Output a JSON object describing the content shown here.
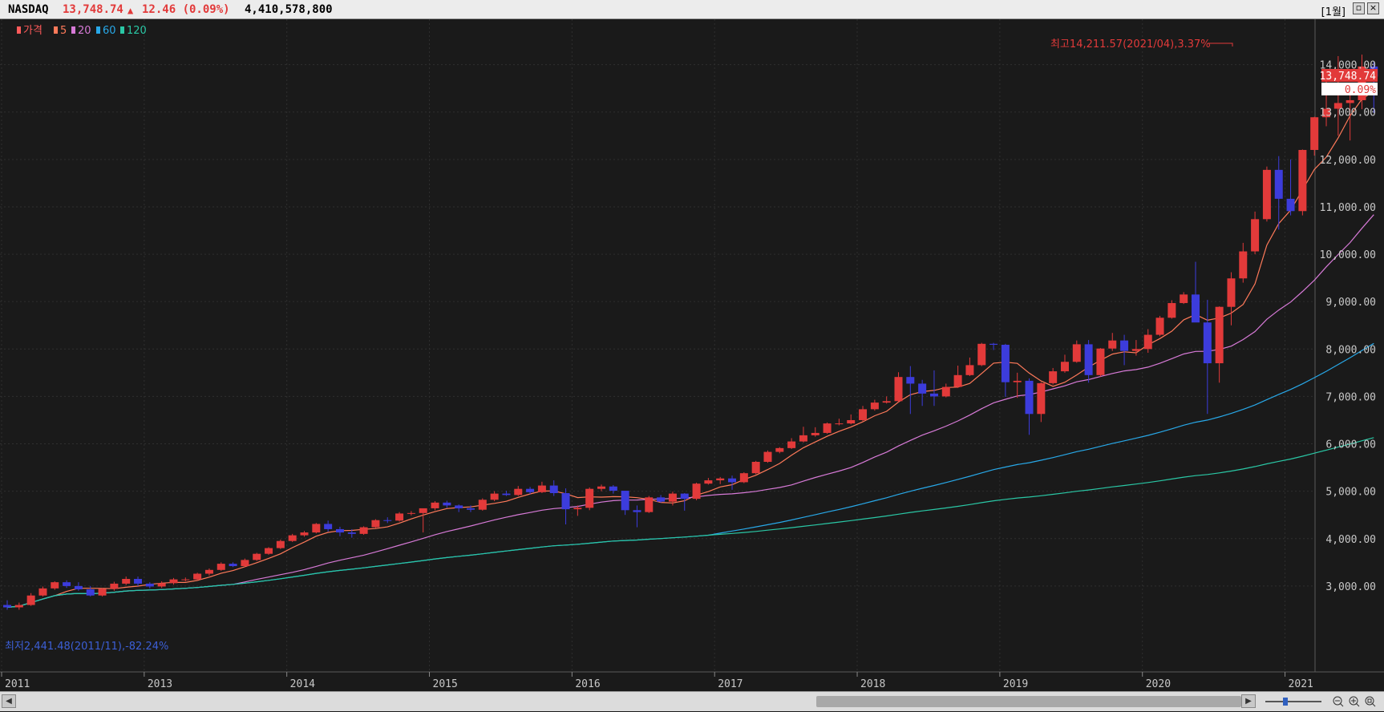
{
  "header": {
    "symbol": "NASDAQ",
    "price": "13,748.74",
    "change_arrow": "▲",
    "change": "12.46 (0.09%)",
    "volume": "4,410,578,800",
    "period": "[1월]",
    "up_color": "#ff4b4b"
  },
  "legend": [
    {
      "label": "가격",
      "color": "#ff5a5a"
    },
    {
      "label": "5",
      "color": "#ff7a5a"
    },
    {
      "label": "20",
      "color": "#d77ad7"
    },
    {
      "label": "60",
      "color": "#28a8e8"
    },
    {
      "label": "120",
      "color": "#2ac7a5"
    }
  ],
  "annotations": {
    "max": "최고14,211.57(2021/04),3.37%",
    "min": "최저2,441.48(2011/11),-82.24%"
  },
  "price_tag": {
    "value": "13,748.74",
    "pct": "0.09%"
  },
  "chart_data": {
    "type": "candlestick",
    "title": "NASDAQ",
    "interval": "monthly",
    "ylim": [
      2000,
      14450
    ],
    "ytick_values": [
      3000,
      4000,
      5000,
      6000,
      7000,
      8000,
      9000,
      10000,
      11000,
      12000,
      13000,
      14000
    ],
    "ytick_labels": [
      "3,000.00",
      "4,000.00",
      "5,000.00",
      "6,000.00",
      "7,000.00",
      "8,000.00",
      "9,000.00",
      "10,000.00",
      "11,000.00",
      "12,000.00",
      "13,000.00",
      "14,000.00"
    ],
    "xtick_labels": [
      {
        "label": "2011",
        "index": 0
      },
      {
        "label": "2013",
        "index": 12
      },
      {
        "label": "2014",
        "index": 24
      },
      {
        "label": "2015",
        "index": 36
      },
      {
        "label": "2016",
        "index": 48
      },
      {
        "label": "2017",
        "index": 60
      },
      {
        "label": "2018",
        "index": 72
      },
      {
        "label": "2019",
        "index": 84
      },
      {
        "label": "2020",
        "index": 96
      },
      {
        "label": "2021",
        "index": 108
      }
    ],
    "candles": [
      {
        "o": 2600,
        "h": 2700,
        "l": 2500,
        "c": 2550
      },
      {
        "o": 2550,
        "h": 2650,
        "l": 2500,
        "c": 2600
      },
      {
        "o": 2600,
        "h": 2850,
        "l": 2580,
        "c": 2800
      },
      {
        "o": 2800,
        "h": 2990,
        "l": 2780,
        "c": 2950
      },
      {
        "o": 2950,
        "h": 3100,
        "l": 2920,
        "c": 3080
      },
      {
        "o": 3080,
        "h": 3120,
        "l": 2960,
        "c": 3000
      },
      {
        "o": 3000,
        "h": 3080,
        "l": 2900,
        "c": 2930
      },
      {
        "o": 2930,
        "h": 3000,
        "l": 2780,
        "c": 2800
      },
      {
        "o": 2800,
        "h": 2960,
        "l": 2780,
        "c": 2940
      },
      {
        "o": 2940,
        "h": 3090,
        "l": 2900,
        "c": 3050
      },
      {
        "o": 3050,
        "h": 3200,
        "l": 3020,
        "c": 3150
      },
      {
        "o": 3150,
        "h": 3200,
        "l": 3000,
        "c": 3050
      },
      {
        "o": 3050,
        "h": 3080,
        "l": 2950,
        "c": 2990
      },
      {
        "o": 2990,
        "h": 3100,
        "l": 2960,
        "c": 3060
      },
      {
        "o": 3060,
        "h": 3170,
        "l": 3030,
        "c": 3140
      },
      {
        "o": 3140,
        "h": 3180,
        "l": 3100,
        "c": 3140
      },
      {
        "o": 3140,
        "h": 3280,
        "l": 3120,
        "c": 3260
      },
      {
        "o": 3260,
        "h": 3370,
        "l": 3220,
        "c": 3340
      },
      {
        "o": 3340,
        "h": 3500,
        "l": 3320,
        "c": 3470
      },
      {
        "o": 3470,
        "h": 3500,
        "l": 3400,
        "c": 3420
      },
      {
        "o": 3420,
        "h": 3580,
        "l": 3400,
        "c": 3550
      },
      {
        "o": 3550,
        "h": 3700,
        "l": 3530,
        "c": 3680
      },
      {
        "o": 3680,
        "h": 3820,
        "l": 3660,
        "c": 3800
      },
      {
        "o": 3800,
        "h": 3980,
        "l": 3780,
        "c": 3950
      },
      {
        "o": 3950,
        "h": 4100,
        "l": 3930,
        "c": 4070
      },
      {
        "o": 4070,
        "h": 4160,
        "l": 4040,
        "c": 4130
      },
      {
        "o": 4130,
        "h": 4330,
        "l": 4110,
        "c": 4310
      },
      {
        "o": 4310,
        "h": 4380,
        "l": 4150,
        "c": 4200
      },
      {
        "o": 4200,
        "h": 4250,
        "l": 4050,
        "c": 4130
      },
      {
        "o": 4130,
        "h": 4200,
        "l": 4020,
        "c": 4100
      },
      {
        "o": 4100,
        "h": 4260,
        "l": 4080,
        "c": 4240
      },
      {
        "o": 4240,
        "h": 4410,
        "l": 4220,
        "c": 4390
      },
      {
        "o": 4390,
        "h": 4450,
        "l": 4330,
        "c": 4380
      },
      {
        "o": 4380,
        "h": 4560,
        "l": 4360,
        "c": 4530
      },
      {
        "o": 4530,
        "h": 4580,
        "l": 4490,
        "c": 4540
      },
      {
        "o": 4540,
        "h": 4610,
        "l": 4130,
        "c": 4640
      },
      {
        "o": 4640,
        "h": 4790,
        "l": 4600,
        "c": 4760
      },
      {
        "o": 4760,
        "h": 4800,
        "l": 4650,
        "c": 4700
      },
      {
        "o": 4700,
        "h": 4720,
        "l": 4560,
        "c": 4640
      },
      {
        "o": 4640,
        "h": 4700,
        "l": 4560,
        "c": 4610
      },
      {
        "o": 4610,
        "h": 4850,
        "l": 4590,
        "c": 4820
      },
      {
        "o": 4820,
        "h": 5000,
        "l": 4790,
        "c": 4950
      },
      {
        "o": 4950,
        "h": 5010,
        "l": 4900,
        "c": 4920
      },
      {
        "o": 4920,
        "h": 5110,
        "l": 4900,
        "c": 5050
      },
      {
        "o": 5050,
        "h": 5090,
        "l": 4940,
        "c": 4980
      },
      {
        "o": 4980,
        "h": 5200,
        "l": 4960,
        "c": 5120
      },
      {
        "o": 5120,
        "h": 5230,
        "l": 4900,
        "c": 4960
      },
      {
        "o": 4960,
        "h": 5060,
        "l": 4300,
        "c": 4620
      },
      {
        "o": 4620,
        "h": 4700,
        "l": 4480,
        "c": 4650
      },
      {
        "o": 4650,
        "h": 5080,
        "l": 4600,
        "c": 5050
      },
      {
        "o": 5050,
        "h": 5140,
        "l": 5000,
        "c": 5100
      },
      {
        "o": 5100,
        "h": 5130,
        "l": 4950,
        "c": 5010
      },
      {
        "o": 5010,
        "h": 5000,
        "l": 4500,
        "c": 4600
      },
      {
        "o": 4600,
        "h": 4700,
        "l": 4240,
        "c": 4560
      },
      {
        "o": 4560,
        "h": 4900,
        "l": 4540,
        "c": 4870
      },
      {
        "o": 4870,
        "h": 4920,
        "l": 4760,
        "c": 4780
      },
      {
        "o": 4780,
        "h": 4990,
        "l": 4700,
        "c": 4950
      },
      {
        "o": 4950,
        "h": 4960,
        "l": 4590,
        "c": 4840
      },
      {
        "o": 4840,
        "h": 5180,
        "l": 4810,
        "c": 5160
      },
      {
        "o": 5160,
        "h": 5280,
        "l": 5140,
        "c": 5230
      },
      {
        "o": 5230,
        "h": 5300,
        "l": 5150,
        "c": 5270
      },
      {
        "o": 5270,
        "h": 5330,
        "l": 5030,
        "c": 5190
      },
      {
        "o": 5190,
        "h": 5400,
        "l": 5170,
        "c": 5380
      },
      {
        "o": 5380,
        "h": 5640,
        "l": 5360,
        "c": 5620
      },
      {
        "o": 5620,
        "h": 5860,
        "l": 5600,
        "c": 5830
      },
      {
        "o": 5830,
        "h": 5930,
        "l": 5800,
        "c": 5910
      },
      {
        "o": 5910,
        "h": 6120,
        "l": 5890,
        "c": 6050
      },
      {
        "o": 6050,
        "h": 6360,
        "l": 6030,
        "c": 6180
      },
      {
        "o": 6180,
        "h": 6350,
        "l": 6150,
        "c": 6230
      },
      {
        "o": 6230,
        "h": 6450,
        "l": 6210,
        "c": 6430
      },
      {
        "o": 6430,
        "h": 6530,
        "l": 6390,
        "c": 6430
      },
      {
        "o": 6430,
        "h": 6620,
        "l": 6410,
        "c": 6500
      },
      {
        "o": 6500,
        "h": 6800,
        "l": 6480,
        "c": 6730
      },
      {
        "o": 6730,
        "h": 6930,
        "l": 6700,
        "c": 6870
      },
      {
        "o": 6870,
        "h": 7000,
        "l": 6850,
        "c": 6900
      },
      {
        "o": 6900,
        "h": 7510,
        "l": 6880,
        "c": 7410
      },
      {
        "o": 7410,
        "h": 7640,
        "l": 6630,
        "c": 7270
      },
      {
        "o": 7270,
        "h": 7350,
        "l": 6800,
        "c": 7060
      },
      {
        "o": 7060,
        "h": 7550,
        "l": 6800,
        "c": 7000
      },
      {
        "o": 7000,
        "h": 7270,
        "l": 6980,
        "c": 7200
      },
      {
        "o": 7200,
        "h": 7650,
        "l": 7180,
        "c": 7450
      },
      {
        "o": 7450,
        "h": 7820,
        "l": 7430,
        "c": 7660
      },
      {
        "o": 7660,
        "h": 8130,
        "l": 7640,
        "c": 8110
      },
      {
        "o": 8110,
        "h": 8130,
        "l": 7980,
        "c": 8090
      },
      {
        "o": 8090,
        "h": 8110,
        "l": 6990,
        "c": 7300
      },
      {
        "o": 7300,
        "h": 7500,
        "l": 6970,
        "c": 7330
      },
      {
        "o": 7330,
        "h": 7380,
        "l": 6190,
        "c": 6630
      },
      {
        "o": 6630,
        "h": 7300,
        "l": 6460,
        "c": 7280
      },
      {
        "o": 7280,
        "h": 7600,
        "l": 7250,
        "c": 7530
      },
      {
        "o": 7530,
        "h": 7880,
        "l": 7500,
        "c": 7730
      },
      {
        "o": 7730,
        "h": 8180,
        "l": 7710,
        "c": 8100
      },
      {
        "o": 8100,
        "h": 8190,
        "l": 7290,
        "c": 7450
      },
      {
        "o": 7450,
        "h": 8020,
        "l": 7420,
        "c": 8010
      },
      {
        "o": 8010,
        "h": 8340,
        "l": 7960,
        "c": 8180
      },
      {
        "o": 8180,
        "h": 8300,
        "l": 7660,
        "c": 7960
      },
      {
        "o": 7960,
        "h": 8190,
        "l": 7860,
        "c": 8000
      },
      {
        "o": 8000,
        "h": 8420,
        "l": 7920,
        "c": 8300
      },
      {
        "o": 8300,
        "h": 8700,
        "l": 8270,
        "c": 8660
      },
      {
        "o": 8660,
        "h": 9030,
        "l": 8640,
        "c": 8970
      },
      {
        "o": 8970,
        "h": 9200,
        "l": 8950,
        "c": 9150
      },
      {
        "o": 9150,
        "h": 9840,
        "l": 9100,
        "c": 8560
      },
      {
        "o": 8560,
        "h": 9040,
        "l": 6630,
        "c": 7700
      },
      {
        "o": 7700,
        "h": 8900,
        "l": 7290,
        "c": 8890
      },
      {
        "o": 8890,
        "h": 9620,
        "l": 8500,
        "c": 9490
      },
      {
        "o": 9490,
        "h": 10240,
        "l": 9400,
        "c": 10060
      },
      {
        "o": 10060,
        "h": 10900,
        "l": 10000,
        "c": 10740
      },
      {
        "o": 10740,
        "h": 11850,
        "l": 10690,
        "c": 11780
      },
      {
        "o": 11780,
        "h": 12070,
        "l": 10520,
        "c": 11170
      },
      {
        "o": 11170,
        "h": 12000,
        "l": 10820,
        "c": 10910
      },
      {
        "o": 10910,
        "h": 12210,
        "l": 10820,
        "c": 12200
      },
      {
        "o": 12200,
        "h": 12900,
        "l": 12080,
        "c": 12890
      },
      {
        "o": 12890,
        "h": 13730,
        "l": 12700,
        "c": 13070
      },
      {
        "o": 13070,
        "h": 14180,
        "l": 12500,
        "c": 13190
      },
      {
        "o": 13190,
        "h": 13620,
        "l": 12400,
        "c": 13250
      },
      {
        "o": 13250,
        "h": 14211.57,
        "l": 13060,
        "c": 13960
      },
      {
        "o": 13960,
        "h": 14070,
        "l": 12980,
        "c": 13748.74
      }
    ]
  }
}
